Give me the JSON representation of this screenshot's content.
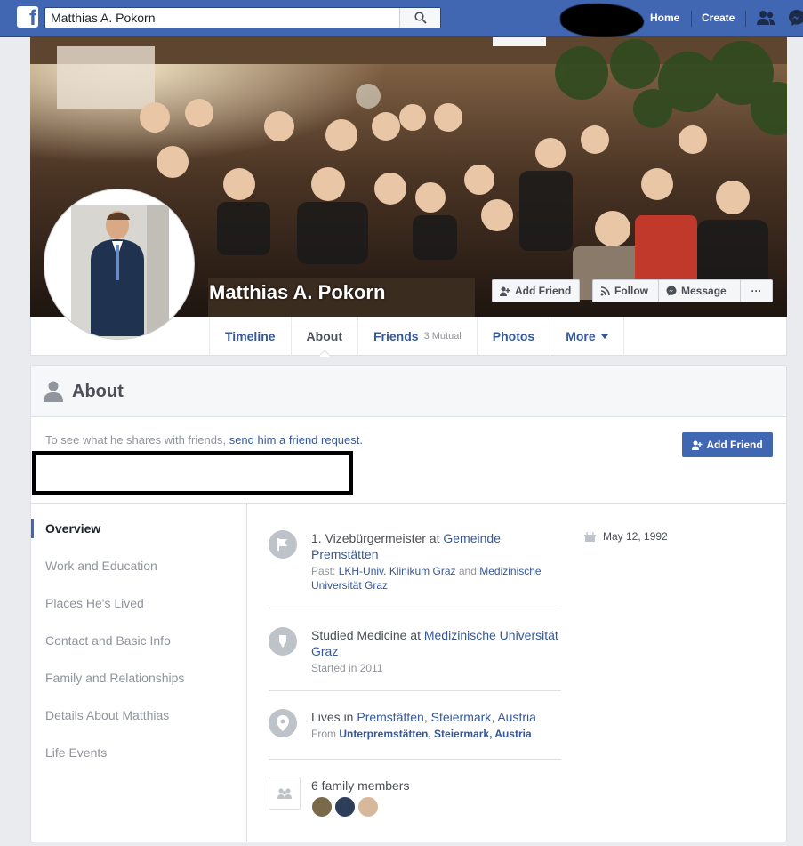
{
  "topbar": {
    "search_value": "Matthias A. Pokorn",
    "home": "Home",
    "create": "Create"
  },
  "profile": {
    "name": "Matthias A. Pokorn",
    "add_friend": "Add Friend",
    "follow": "Follow",
    "message": "Message",
    "more_dots": "···"
  },
  "tabs": {
    "timeline": "Timeline",
    "about": "About",
    "friends": "Friends",
    "friends_mutual": "3 Mutual",
    "photos": "Photos",
    "more": "More"
  },
  "about": {
    "title": "About",
    "notice_text": "To see what he shares with friends,",
    "notice_link": "send him a friend request.",
    "add_friend": "Add Friend"
  },
  "sidebar": {
    "items": [
      "Overview",
      "Work and Education",
      "Places He's Lived",
      "Contact and Basic Info",
      "Family and Relationships",
      "Details About Matthias",
      "Life Events"
    ]
  },
  "overview": {
    "work": {
      "prefix": "1. Vizebürgermeister at",
      "org": "Gemeinde Premstätten",
      "past_label": "Past:",
      "past1": "LKH-Univ. Klinikum Graz",
      "and": "and",
      "past2": "Medizinische Universität Graz"
    },
    "edu": {
      "prefix": "Studied Medicine at",
      "school": "Medizinische Universität Graz",
      "sub": "Started in 2011"
    },
    "lives": {
      "prefix": "Lives in",
      "city": "Premstätten",
      "sep1": ",",
      "region": "Steiermark",
      "sep2": ",",
      "country": "Austria",
      "from_label": "From",
      "from_value": "Unterpremstätten, Steiermark, Austria"
    },
    "family": {
      "text": "6 family members"
    },
    "birthday": "May 12, 1992"
  }
}
